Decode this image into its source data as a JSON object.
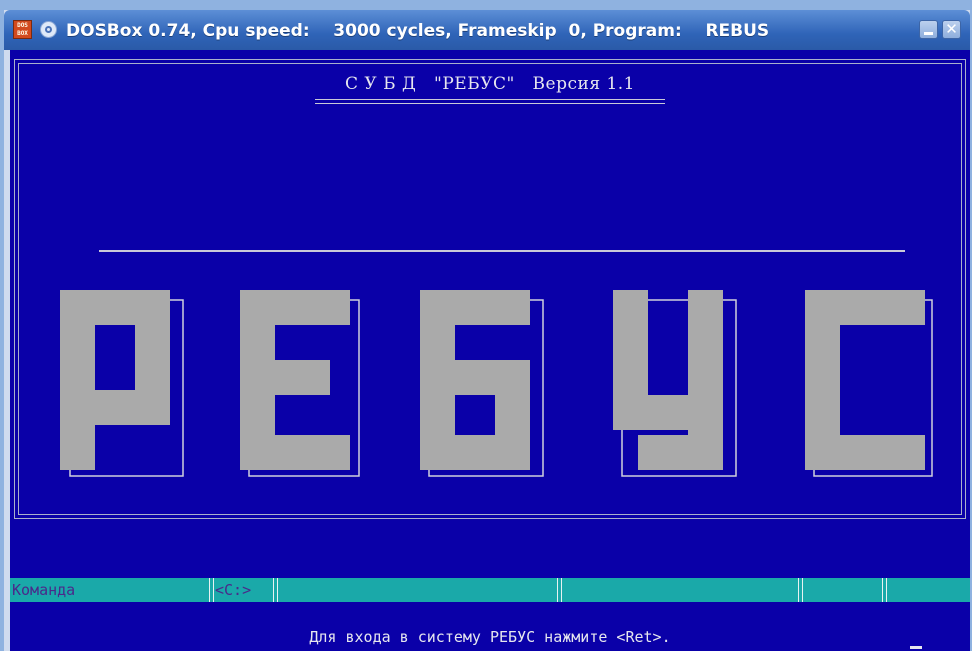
{
  "window": {
    "title": "DOSBox 0.74, Cpu speed:    3000 cycles, Frameskip  0, Program:    REBUS",
    "icon_label": "DOS BOX",
    "minimize": "",
    "close": "✕"
  },
  "screen": {
    "header_title": "С У Б Д   \"РЕБУС\"   Версия 1.1",
    "logo_text": "РЕБУС",
    "colors": {
      "background": "#0a00a8",
      "text": "#e6e6ee",
      "logo": "#aaaaaa",
      "status": "#1aa9a9"
    }
  },
  "statusbar": {
    "command_label": "Команда",
    "drive_label": "<C:>"
  },
  "prompt": "Для входа в систему РЕБУС нажмите <Ret>."
}
